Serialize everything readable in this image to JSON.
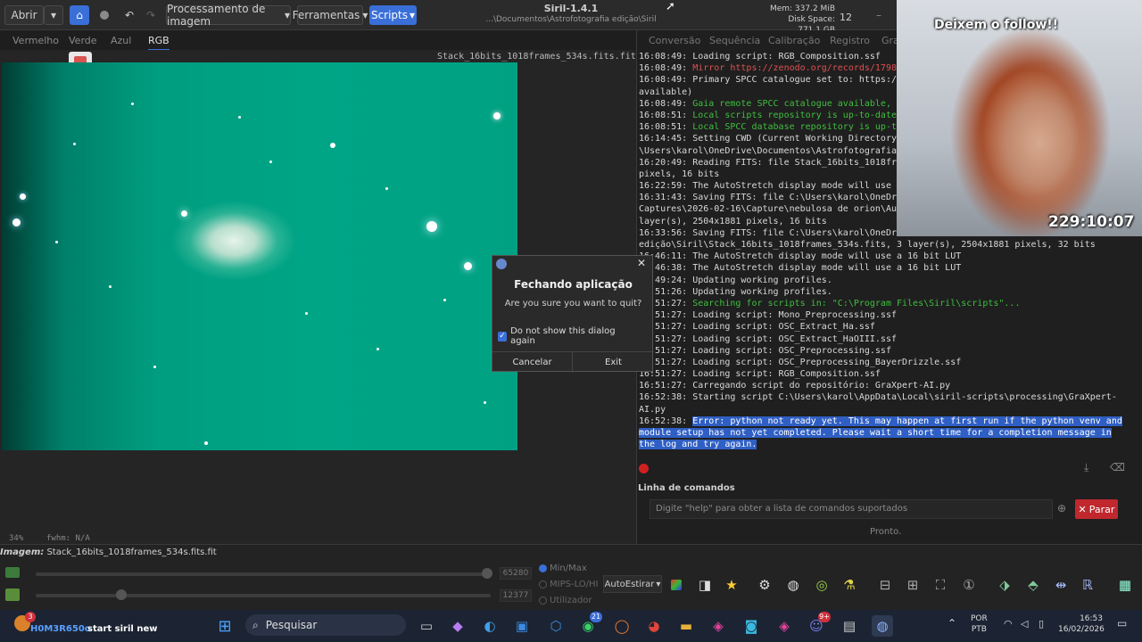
{
  "header": {
    "open_label": "Abrir",
    "menu_processing": "Processamento de imagem",
    "menu_tools": "Ferramentas",
    "menu_scripts": "Scripts",
    "app_title": "Siril-1.4.1",
    "app_path": "...\\Documentos\\Astrofotografia edição\\Siril",
    "mem": "Mem: 337.2 MiB",
    "disk": "Disk Space: 771.1 GB",
    "threads": "12"
  },
  "channels": [
    "Vermelho",
    "Verde",
    "Azul",
    "RGB"
  ],
  "image_filename": "Stack_16bits_1018frames_534s.fits.fit",
  "right_tabs": [
    "Conversão",
    "Sequência",
    "Calibração",
    "Registro",
    "Gra"
  ],
  "log_lines": [
    {
      "time": "16:08:49:",
      "text": "Loading script: RGB_Composition.ssf",
      "color": "normal"
    },
    {
      "time": "16:08:49:",
      "text": "Mirror https://zenodo.org/records/1798",
      "color": "red"
    },
    {
      "time": "16:08:49:",
      "text": "Primary SPCC catalogue set to: https:/",
      "color": "normal"
    },
    {
      "time": "",
      "text": "available)",
      "color": "normal"
    },
    {
      "time": "16:08:49:",
      "text": "Gaia remote SPCC catalogue available,",
      "color": "green"
    },
    {
      "time": "16:08:51:",
      "text": "Local scripts repository is up-to-date",
      "color": "green"
    },
    {
      "time": "16:08:51:",
      "text": "Local SPCC database repository is up-t",
      "color": "green"
    },
    {
      "time": "16:14:45:",
      "text": "Setting CWD (Current Working Directory",
      "color": "normal"
    },
    {
      "time": "",
      "text": "\\Users\\karol\\OneDrive\\Documentos\\Astrofotografia",
      "color": "normal"
    },
    {
      "time": "16:20:49:",
      "text": "Reading FITS: file Stack_16bits_1018fr",
      "color": "normal"
    },
    {
      "time": "",
      "text": "pixels, 16 bits",
      "color": "normal"
    },
    {
      "time": "16:22:59:",
      "text": "The AutoStretch display mode will use",
      "color": "normal"
    },
    {
      "time": "16:31:43:",
      "text": "Saving FITS: file C:\\Users\\karol\\OneDr",
      "color": "normal"
    },
    {
      "time": "",
      "text": "Captures\\2026-02-16\\Capture\\nebulosa de orion\\Au",
      "color": "normal"
    },
    {
      "time": "",
      "text": "layer(s), 2504x1881 pixels, 16 bits",
      "color": "normal"
    },
    {
      "time": "16:33:56:",
      "text": "Saving FITS: file C:\\Users\\karol\\OneDr",
      "color": "normal"
    },
    {
      "time": "",
      "text": "edição\\Siril\\Stack_16bits_1018frames_534s.fits, 3 layer(s), 2504x1881 pixels, 32 bits",
      "color": "normal"
    },
    {
      "time": "16:46:11:",
      "text": "The AutoStretch display mode will use a 16 bit LUT",
      "color": "normal"
    },
    {
      "time": "16:46:38:",
      "text": "The AutoStretch display mode will use a 16 bit LUT",
      "color": "normal"
    },
    {
      "time": "16:49:24:",
      "text": "Updating working profiles.",
      "color": "normal"
    },
    {
      "time": "16:51:26:",
      "text": "Updating working profiles.",
      "color": "normal"
    },
    {
      "time": "16:51:27:",
      "text": "Searching for scripts in: \"C:\\Program Files\\Siril\\scripts\"...",
      "color": "green"
    },
    {
      "time": "16:51:27:",
      "text": "Loading script: Mono_Preprocessing.ssf",
      "color": "normal"
    },
    {
      "time": "16:51:27:",
      "text": "Loading script: OSC_Extract_Ha.ssf",
      "color": "normal"
    },
    {
      "time": "16:51:27:",
      "text": "Loading script: OSC_Extract_HaOIII.ssf",
      "color": "normal"
    },
    {
      "time": "16:51:27:",
      "text": "Loading script: OSC_Preprocessing.ssf",
      "color": "normal"
    },
    {
      "time": "16:51:27:",
      "text": "Loading script: OSC_Preprocessing_BayerDrizzle.ssf",
      "color": "normal"
    },
    {
      "time": "16:51:27:",
      "text": "Loading script: RGB_Composition.ssf",
      "color": "normal"
    },
    {
      "time": "16:51:27:",
      "text": "Carregando script do repositório: GraXpert-AI.py",
      "color": "normal"
    },
    {
      "time": "16:52:38:",
      "text": "Starting script C:\\Users\\karol\\AppData\\Local\\siril-scripts\\processing\\GraXpert-",
      "color": "normal"
    },
    {
      "time": "",
      "text": "AI.py",
      "color": "normal"
    }
  ],
  "error_lines": [
    {
      "time": "16:52:38:",
      "text": "Error: python not ready yet. This may happen at first run if the python venv and"
    },
    {
      "time": "",
      "text": "module setup has not yet completed. Please wait a short time for a completion message in"
    },
    {
      "time": "",
      "text": "the log and try again."
    }
  ],
  "dialog": {
    "title": "Fechando aplicação",
    "message": "Are you sure you want to quit?",
    "checkbox_label": "Do not show this dialog again",
    "cancel_label": "Cancelar",
    "exit_label": "Exit"
  },
  "command": {
    "section_label": "Linha de comandos",
    "placeholder": "Digite \"help\" para obter a lista de comandos suportados",
    "stop_label": "Parar",
    "status": "Pronto."
  },
  "status": {
    "zoom": "34%",
    "fwhm": "fwhm: N/A",
    "image_label": "Imagem:",
    "image_name": "Stack_16bits_1018frames_534s.fits.fit"
  },
  "lower": {
    "high_value": "65280",
    "low_value": "12377",
    "mode_minmax": "Min/Max",
    "mode_mips": "MIPS-LO/HI",
    "mode_user": "Utilizador",
    "stretch_label": "AutoEstirar"
  },
  "webcam": {
    "banner": "Deixem o follow!!",
    "timer": "229:10:07"
  },
  "taskbar": {
    "user": "H0M3R650o",
    "notification_badge": "3",
    "stream_title": "start siril new",
    "search_label": "Pesquisar",
    "whatsapp_badge": "21",
    "discord_badge": "9+",
    "lang_line1": "POR",
    "lang_line2": "PTB",
    "time": "16:53",
    "date": "16/02/2026"
  }
}
